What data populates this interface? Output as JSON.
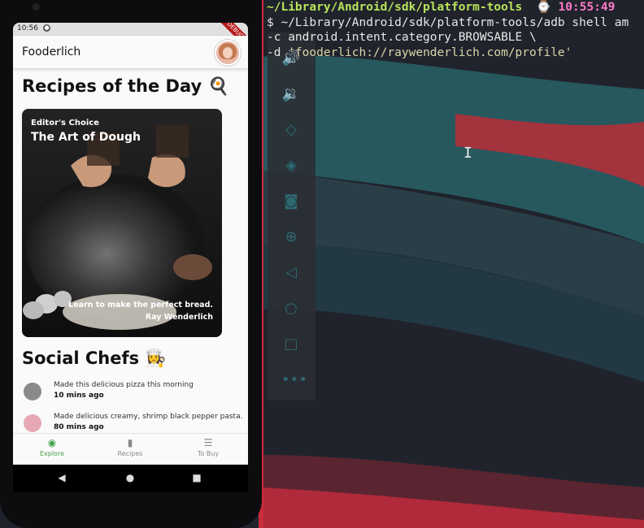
{
  "terminal": {
    "path": "~/Library/Android/sdk/platform-tools",
    "clock": "10:55:49",
    "line1_cmd": "$ ~/Library/Android/sdk/platform-tools/adb shell am",
    "line2": "-c android.intent.category.BROWSABLE \\",
    "line3_prefix": "-d ",
    "line3_uri": "'fooderlich://raywenderlich.com/profile'"
  },
  "emulator_toolbar": {
    "icons": [
      "volume-up-icon",
      "volume-down-icon",
      "rotate-left-icon",
      "rotate-right-icon",
      "camera-icon",
      "zoom-icon",
      "back-icon",
      "home-icon",
      "overview-icon",
      "more-icon"
    ]
  },
  "statusbar": {
    "time": "10:56",
    "debug_banner": "DEBUG"
  },
  "appbar": {
    "title": "Fooderlich"
  },
  "recipes_section": {
    "heading": "Recipes of the Day 🍳"
  },
  "card": {
    "subtitle": "Editor's Choice",
    "title": "The Art of Dough",
    "description": "Learn to make the perfect bread.",
    "author": "Ray Wenderlich"
  },
  "social_section": {
    "heading": "Social Chefs 👩‍🍳"
  },
  "feed": [
    {
      "message": "Made this delicious pizza this morning",
      "time": "10 mins ago"
    },
    {
      "message": "Made delicious creamy, shrimp black pepper pasta.",
      "time": "80 mins ago"
    }
  ],
  "bottom_nav": {
    "tabs": [
      {
        "label": "Explore",
        "icon": "compass-icon",
        "active": true
      },
      {
        "label": "Recipes",
        "icon": "book-icon",
        "active": false
      },
      {
        "label": "To Buy",
        "icon": "list-icon",
        "active": false
      }
    ],
    "active_color": "#43a047"
  }
}
